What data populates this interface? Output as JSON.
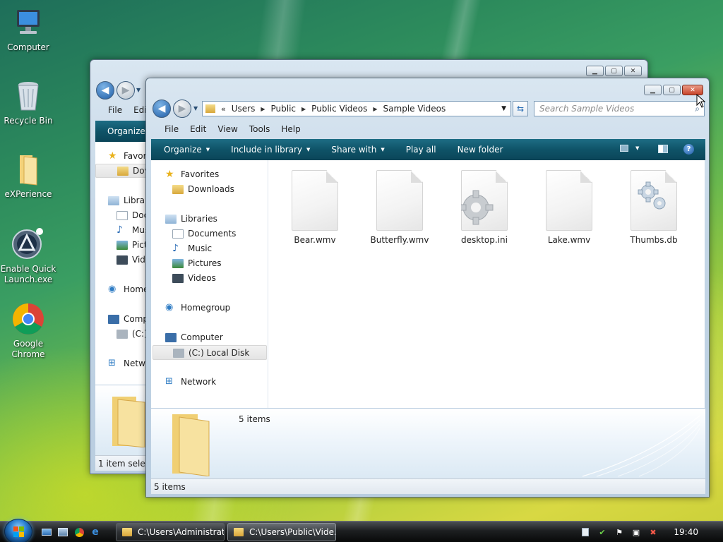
{
  "desktop": {
    "icons": [
      {
        "label": "Computer",
        "icon": "computer-icon"
      },
      {
        "label": "Recycle Bin",
        "icon": "recycle-bin-icon"
      },
      {
        "label": "eXPerience",
        "icon": "folder-icon"
      },
      {
        "label": "Enable Quick Launch.exe",
        "icon": "quick-launch-icon"
      },
      {
        "label": "Google Chrome",
        "icon": "chrome-icon"
      }
    ]
  },
  "back_window": {
    "menu": [
      "File",
      "Edit"
    ],
    "command": "Organize",
    "nav_items": [
      "Favorites",
      "Downloads",
      "Libraries",
      "Documents",
      "Music",
      "Pictures",
      "Videos",
      "Homegroup",
      "Computer",
      "(C:)",
      "Network"
    ],
    "status": "1 item selected"
  },
  "front_window": {
    "breadcrumb": [
      "Users",
      "Public",
      "Public Videos",
      "Sample Videos"
    ],
    "search_placeholder": "Search Sample Videos",
    "menu": [
      "File",
      "Edit",
      "View",
      "Tools",
      "Help"
    ],
    "commands": [
      {
        "label": "Organize",
        "dropdown": true
      },
      {
        "label": "Include in library",
        "dropdown": true
      },
      {
        "label": "Share with",
        "dropdown": true
      },
      {
        "label": "Play all",
        "dropdown": false
      },
      {
        "label": "New folder",
        "dropdown": false
      }
    ],
    "nav": {
      "favorites": "Favorites",
      "downloads": "Downloads",
      "libraries": "Libraries",
      "documents": "Documents",
      "music": "Music",
      "pictures": "Pictures",
      "videos": "Videos",
      "homegroup": "Homegroup",
      "computer": "Computer",
      "local_disk": "(C:) Local Disk",
      "network": "Network"
    },
    "files": [
      {
        "name": "Bear.wmv",
        "type": "document"
      },
      {
        "name": "Butterfly.wmv",
        "type": "document"
      },
      {
        "name": "desktop.ini",
        "type": "settings"
      },
      {
        "name": "Lake.wmv",
        "type": "document"
      },
      {
        "name": "Thumbs.db",
        "type": "settings"
      }
    ],
    "details_count": "5 items",
    "status": "5 items"
  },
  "taskbar": {
    "tasks": [
      {
        "label": "C:\\Users\\Administrat..."
      },
      {
        "label": "C:\\Users\\Public\\Vide..."
      }
    ],
    "clock": "19:40"
  }
}
